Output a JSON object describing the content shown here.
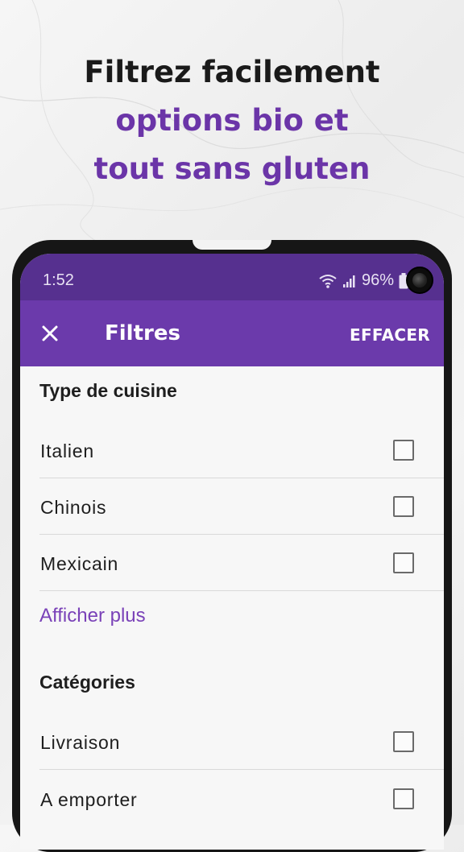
{
  "promo": {
    "line1": "Filtrez facilement",
    "line2": "options bio et",
    "line3": "tout sans gluten"
  },
  "status_bar": {
    "time": "1:52",
    "battery": "96%",
    "icons": [
      "wifi-icon",
      "signal-icon",
      "battery-icon"
    ]
  },
  "app_bar": {
    "close_icon": "close-icon",
    "title": "Filtres",
    "clear_label": "EFFACER"
  },
  "sections": {
    "cuisine": {
      "title": "Type de cuisine",
      "items": [
        {
          "label": "Italien",
          "checked": false
        },
        {
          "label": "Chinois",
          "checked": false
        },
        {
          "label": "Mexicain",
          "checked": false
        }
      ],
      "show_more": "Afficher plus"
    },
    "categories": {
      "title": "Catégories",
      "items": [
        {
          "label": "Livraison",
          "checked": false
        },
        {
          "label": "A emporter",
          "checked": false
        }
      ]
    }
  },
  "colors": {
    "status_bar": "#56308f",
    "app_bar": "#6b3aab",
    "accent": "#6b35a8",
    "link": "#7a42b8"
  }
}
